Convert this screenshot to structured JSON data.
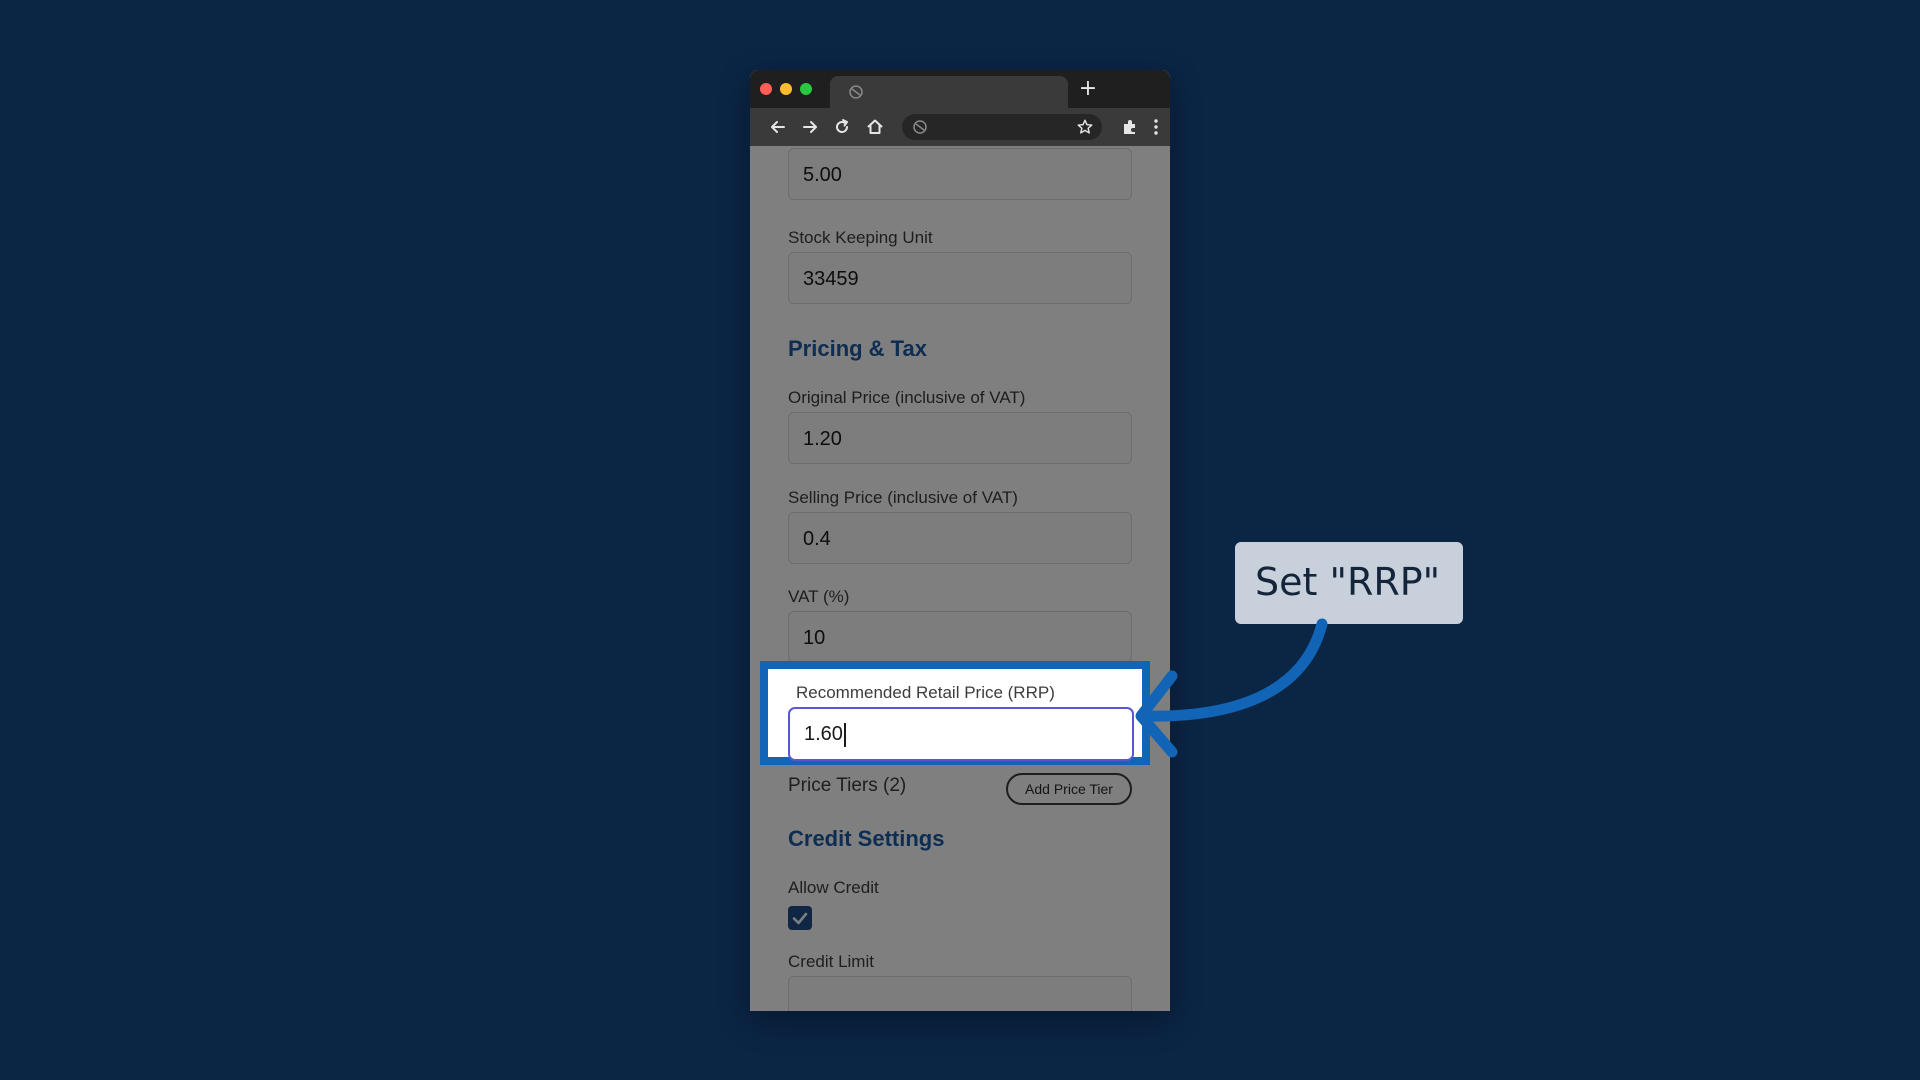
{
  "browser": {
    "tab_icon": "globe-icon",
    "new_tab_label": "+",
    "toolbar_icons": [
      "back-arrow-icon",
      "forward-arrow-icon",
      "reload-icon",
      "home-icon",
      "globe-icon",
      "star-icon",
      "extensions-icon",
      "more-menu-icon"
    ]
  },
  "form": {
    "top_field_value": "5.00",
    "sku_label": "Stock Keeping Unit",
    "sku_value": "33459",
    "pricing_section": "Pricing & Tax",
    "original_price_label": "Original Price (inclusive of VAT)",
    "original_price_value": "1.20",
    "selling_price_label": "Selling Price (inclusive of VAT)",
    "selling_price_value": "0.4",
    "vat_label": "VAT (%)",
    "vat_value": "10",
    "rrp_label": "Recommended Retail Price (RRP)",
    "rrp_value": "1.60",
    "price_tiers_label": "Price Tiers (2)",
    "add_price_tier_label": "Add Price Tier",
    "credit_section": "Credit Settings",
    "allow_credit_label": "Allow Credit",
    "allow_credit_checked": true,
    "credit_limit_label": "Credit Limit"
  },
  "callout": {
    "text": "Set \"RRP\""
  },
  "colors": {
    "background": "#0b2545",
    "highlight": "#1264b6",
    "section_title": "#1b5aa6",
    "input_focus": "#5a56d6"
  }
}
